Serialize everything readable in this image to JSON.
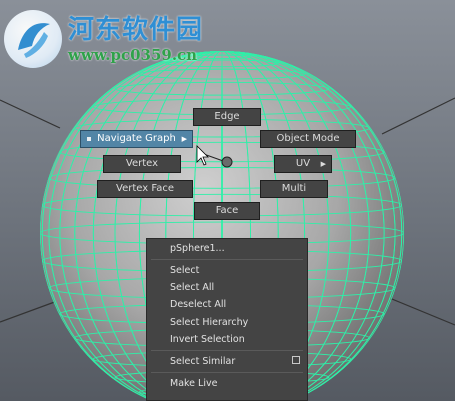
{
  "marking_menu": {
    "edge": "Edge",
    "navigate_graph": "Navigate Graph",
    "object_mode": "Object Mode",
    "vertex": "Vertex",
    "uv": "UV",
    "vertex_face": "Vertex Face",
    "multi": "Multi",
    "face": "Face",
    "highlighted_item": "Navigate Graph"
  },
  "context_menu": {
    "object_name": "pSphere1...",
    "items": [
      "Select",
      "Select All",
      "Deselect All",
      "Select Hierarchy",
      "Invert Selection",
      "Select Similar",
      "Make Live"
    ],
    "select_similar_option_checked": false
  },
  "watermark": {
    "title": "河东软件园",
    "url": "www.pc0359.cn"
  },
  "colors": {
    "wireframe": "#2ef0a8",
    "menu_bg": "#444444",
    "highlight": "#5285a6",
    "watermark_title": "#2f8fd4",
    "watermark_url": "#2fa24a"
  },
  "icons": [
    "arrow-right-icon",
    "mouse-cursor-icon",
    "checkbox-icon",
    "logo-icon"
  ]
}
